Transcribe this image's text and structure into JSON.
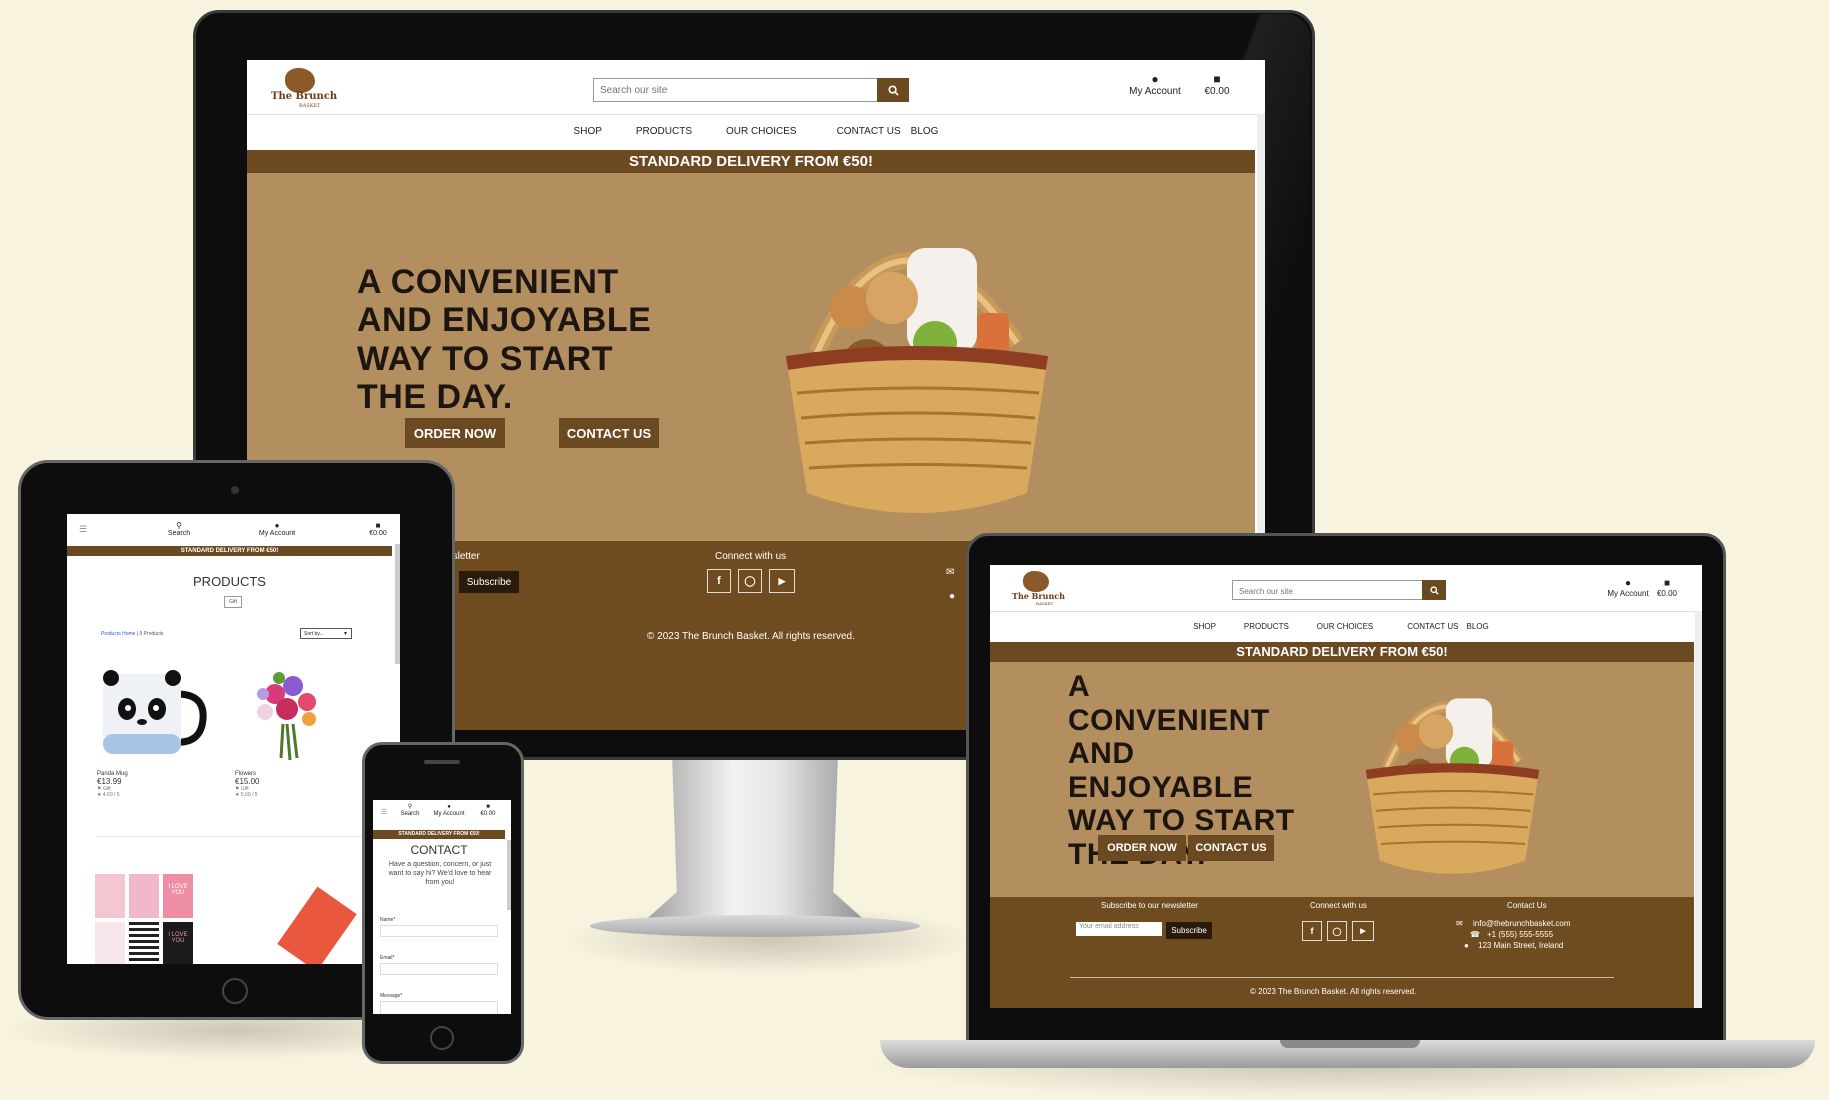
{
  "site": {
    "logo_text": "The Brunch",
    "logo_sub": "BASKET",
    "search_placeholder": "Search our site",
    "account_label": "My Account",
    "cart_label": "€0.00",
    "search_label": "Search",
    "nav": [
      "SHOP",
      "PRODUCTS",
      "OUR CHOICES",
      "CONTACT US",
      "BLOG"
    ],
    "banner": "STANDARD DELIVERY FROM €50!",
    "hero_title": "A CONVENIENT AND ENJOYABLE WAY TO START THE DAY.",
    "order_btn": "ORDER NOW",
    "contact_btn": "CONTACT US",
    "footer": {
      "newsletter_heading": "Subscribe to our newsletter",
      "newsletter_heading_cropped": "be to our newsletter",
      "email_placeholder": "Your email address",
      "email_placeholder_cropped": "dress",
      "subscribe_btn": "Subscribe",
      "connect_heading": "Connect with us",
      "contact_heading": "Contact Us",
      "email": "info@thebrunchbasket.com",
      "phone": "+1 (555) 555-5555",
      "address": "123 Main Street, Ireland",
      "copyright": "© 2023 The Brunch Basket. All rights reserved."
    }
  },
  "tablet": {
    "page_title": "PRODUCTS",
    "filter_tag": "Gift",
    "breadcrumb_link": "Products Home",
    "breadcrumb_count": " | 9 Products",
    "sort_label": "Sort by...",
    "products": [
      {
        "name": "Panda Mug",
        "price": "€13.99",
        "category": "Gift",
        "rating": "4.60 / 5"
      },
      {
        "name": "Flowers",
        "price": "€15.00",
        "category": "Gift",
        "rating": "5.00 / 5"
      }
    ],
    "card_text": [
      "I LOVE YOU",
      "I LOVE YOU",
      "I LOVE YOU"
    ]
  },
  "phone": {
    "page_title": "CONTACT",
    "intro": "Have a question, concern, or just want to say hi? We'd love to hear from you!",
    "fields": [
      "Name*",
      "Email*",
      "Message*"
    ]
  },
  "colors": {
    "brand_brown": "#6b4a22",
    "hero_tan": "#b38f60",
    "footer_brown": "#6e4c20",
    "background": "#f8f3de"
  }
}
